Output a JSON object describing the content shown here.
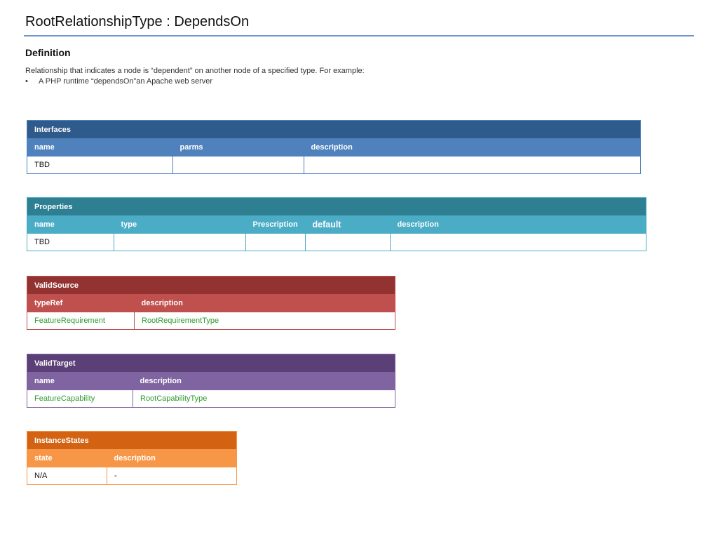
{
  "title": "RootRelationshipType : DependsOn",
  "definition": {
    "heading": "Definition",
    "text": "Relationship that indicates a node is “dependent” on another node of a specified type. For example:",
    "bullet_marker": "•",
    "bullet": "A PHP runtime “dependsOn”an Apache web server"
  },
  "interfaces": {
    "caption": "Interfaces",
    "columns": [
      "name",
      "parms",
      "description"
    ],
    "rows": [
      [
        "TBD",
        "",
        ""
      ]
    ]
  },
  "properties": {
    "caption": "Properties",
    "columns": [
      "name",
      "type",
      "Prescription",
      "default",
      "description"
    ],
    "rows": [
      [
        "TBD",
        "",
        "",
        "",
        ""
      ]
    ]
  },
  "valid_source": {
    "caption": "ValidSource",
    "columns": [
      "typeRef",
      "description"
    ],
    "rows": [
      [
        "FeatureRequirement",
        "RootRequirementType"
      ]
    ]
  },
  "valid_target": {
    "caption": "ValidTarget",
    "columns": [
      "name",
      "description"
    ],
    "rows": [
      [
        "FeatureCapability",
        "RootCapabilityType"
      ]
    ]
  },
  "instance_states": {
    "caption": "InstanceStates",
    "columns": [
      "state",
      "description"
    ],
    "rows": [
      [
        "N/A",
        "-"
      ]
    ]
  },
  "colors": {
    "interfaces": "#4f81bd",
    "properties": "#4bacc6",
    "valid_source": "#c0504d",
    "valid_target": "#8064a2",
    "instance_states": "#f79646",
    "link_text": "#2f9a2f"
  }
}
